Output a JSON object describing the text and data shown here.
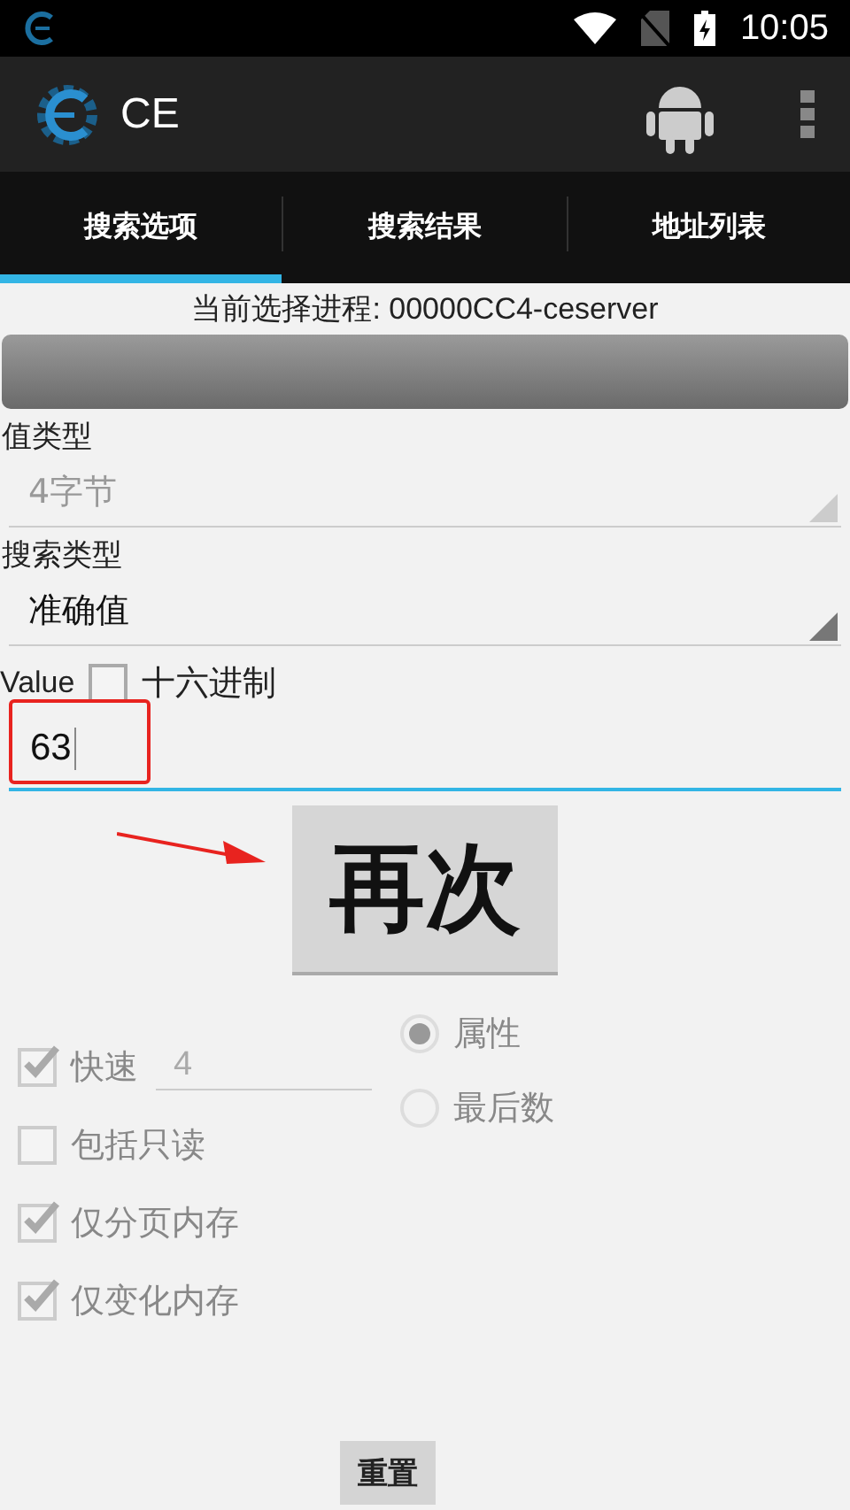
{
  "status_bar": {
    "time": "10:05"
  },
  "app_bar": {
    "title": "CE"
  },
  "tabs": [
    {
      "label": "搜索选项",
      "selected": true
    },
    {
      "label": "搜索结果",
      "selected": false
    },
    {
      "label": "地址列表",
      "selected": false
    }
  ],
  "process": {
    "text": "当前选择进程: 00000CC4-ceserver",
    "level": 0
  },
  "value_type": {
    "label": "值类型",
    "value": "4字节",
    "disabled": true
  },
  "scan_type": {
    "label": "搜索类型",
    "value": "准确值",
    "disabled": false
  },
  "value": {
    "label": "Value",
    "hex": {
      "label": "十六进制",
      "checked": false
    },
    "input": "63"
  },
  "scan_button": {
    "label": "再次"
  },
  "fast_scan": {
    "label": "快速",
    "checked": true,
    "disabled": true,
    "value": "4"
  },
  "alignment": [
    {
      "label": "属性",
      "selected": true,
      "disabled": true
    },
    {
      "label": "最后数",
      "selected": false,
      "disabled": true
    }
  ],
  "options": [
    {
      "label": "包括只读",
      "checked": false,
      "disabled": true
    },
    {
      "label": "仅分页内存",
      "checked": true,
      "disabled": true
    },
    {
      "label": "仅变化内存",
      "checked": true,
      "disabled": true
    }
  ],
  "reset_button": {
    "label": "重置"
  }
}
